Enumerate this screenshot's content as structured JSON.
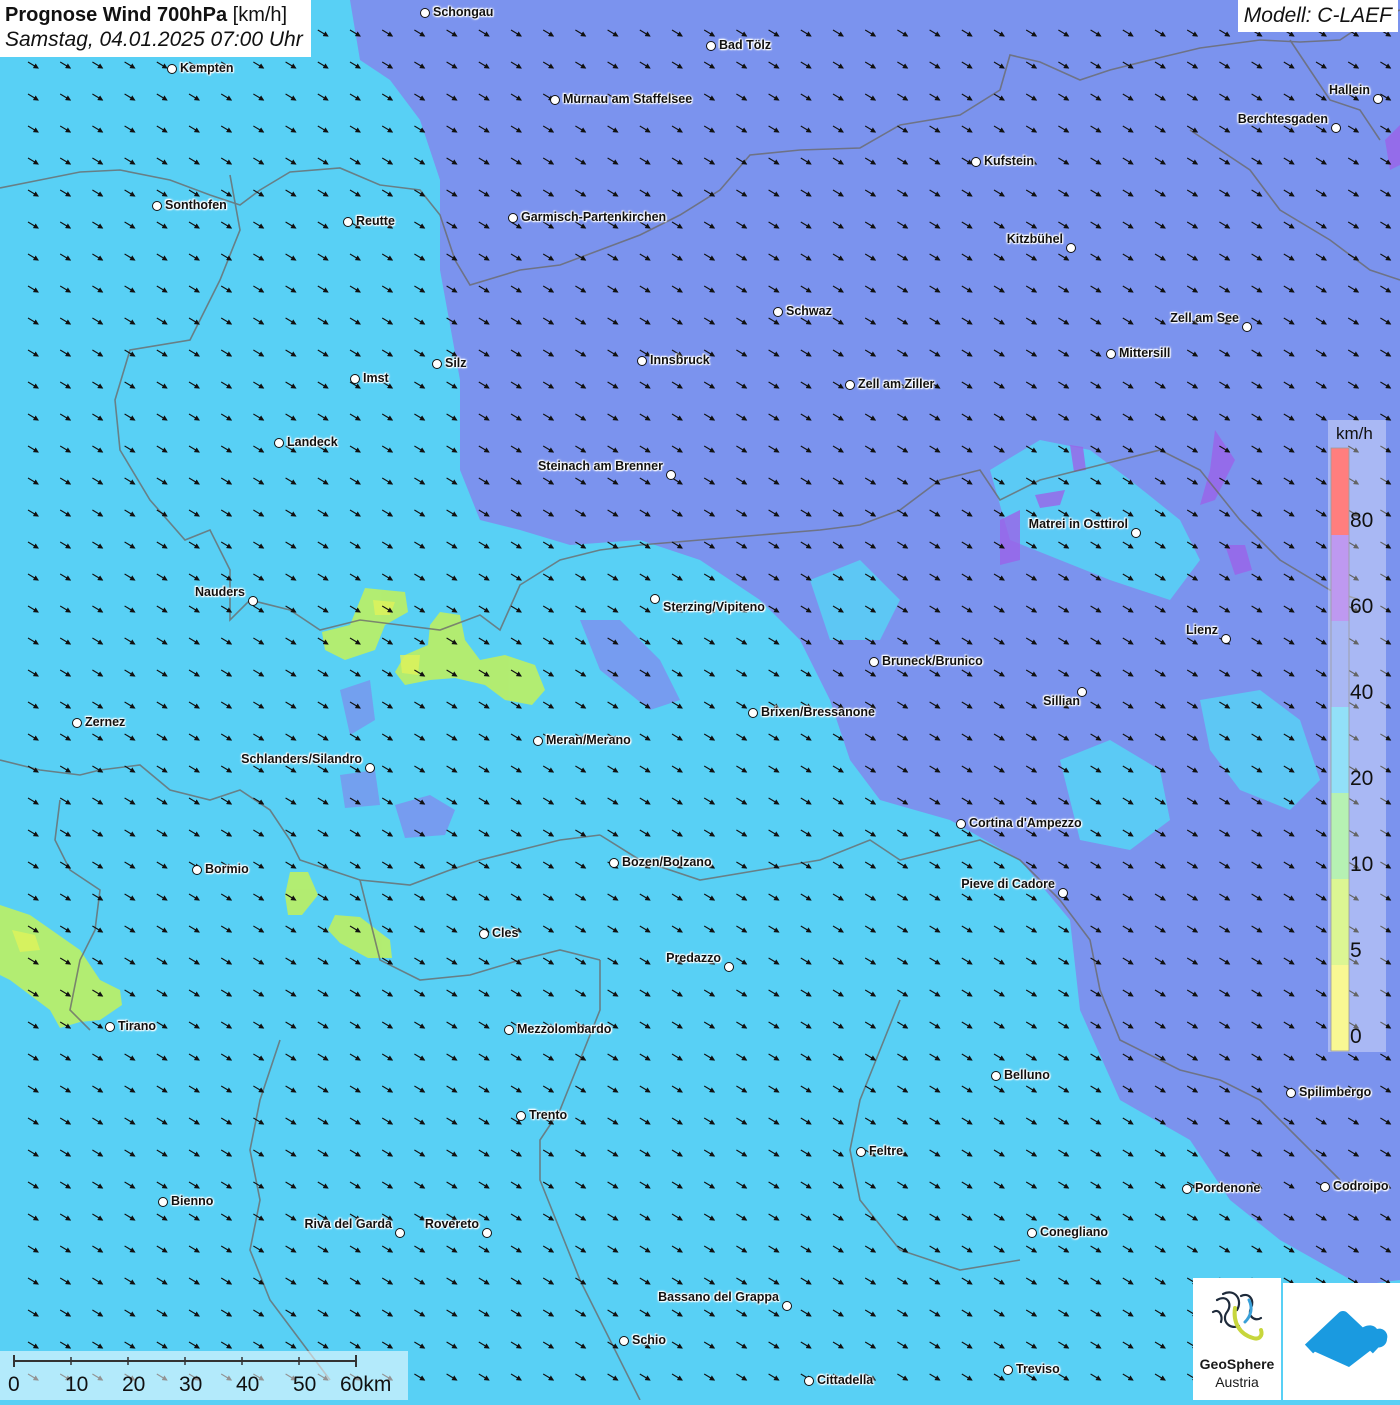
{
  "title": {
    "main": "Prognose Wind 700hPa",
    "unit": "[km/h]",
    "datetime": "Samstag, 04.01.2025 07:00 Uhr"
  },
  "model": "Modell: C-LAEF",
  "colors": {
    "wind_0_5": "#f6f55a",
    "wind_5_10": "#c9f15a",
    "wind_10_20": "#8fea8a",
    "wind_20_40": "#58d0f5",
    "wind_40_60": "#7b93ee",
    "wind_60_80": "#9b63e8",
    "wind_80_plus": "#ff3a3a",
    "border_lines": "#6b6b6b"
  },
  "legend": {
    "unit": "km/h",
    "ticks": [
      "0",
      "5",
      "10",
      "20",
      "40",
      "60",
      "80"
    ]
  },
  "scalebar": {
    "labels": [
      "0",
      "10",
      "20",
      "30",
      "40",
      "50",
      "60km"
    ]
  },
  "cities": [
    {
      "name": "Schongau"
    },
    {
      "name": "Bad Tölz"
    },
    {
      "name": "Kempten"
    },
    {
      "name": "Murnau am Staffelsee"
    },
    {
      "name": "Hallein"
    },
    {
      "name": "Berchtesgaden"
    },
    {
      "name": "Kufstein"
    },
    {
      "name": "Sonthofen"
    },
    {
      "name": "Reutte"
    },
    {
      "name": "Garmisch-Partenkirchen"
    },
    {
      "name": "Kitzbühel"
    },
    {
      "name": "Schwaz"
    },
    {
      "name": "Zell am See"
    },
    {
      "name": "Mittersill"
    },
    {
      "name": "Innsbruck"
    },
    {
      "name": "Silz"
    },
    {
      "name": "Imst"
    },
    {
      "name": "Zell am Ziller"
    },
    {
      "name": "Landeck"
    },
    {
      "name": "Steinach am Brenner"
    },
    {
      "name": "Matrei in Osttirol"
    },
    {
      "name": "Nauders"
    },
    {
      "name": "Sterzing/Vipiteno"
    },
    {
      "name": "Lienz"
    },
    {
      "name": "Bruneck/Brunico"
    },
    {
      "name": "Sillian"
    },
    {
      "name": "Brixen/Bressanone"
    },
    {
      "name": "Zernez"
    },
    {
      "name": "Meran/Merano"
    },
    {
      "name": "Schlanders/Silandro"
    },
    {
      "name": "Cortina d'Ampezzo"
    },
    {
      "name": "Bozen/Bolzano"
    },
    {
      "name": "Bormio"
    },
    {
      "name": "Pieve di Cadore"
    },
    {
      "name": "Cles"
    },
    {
      "name": "Predazzo"
    },
    {
      "name": "Tirano"
    },
    {
      "name": "Mezzolombardo"
    },
    {
      "name": "Belluno"
    },
    {
      "name": "Spilimbergo"
    },
    {
      "name": "Trento"
    },
    {
      "name": "Feltre"
    },
    {
      "name": "Pordenone"
    },
    {
      "name": "Codroipo"
    },
    {
      "name": "Bienno"
    },
    {
      "name": "Riva del Garda"
    },
    {
      "name": "Rovereto"
    },
    {
      "name": "Conegliano"
    },
    {
      "name": "Bassano del Grappa"
    },
    {
      "name": "Schio"
    },
    {
      "name": "Treviso"
    },
    {
      "name": "Cittadella"
    }
  ],
  "logos": {
    "geosphere_name": "GeoSphere",
    "geosphere_country": "Austria"
  },
  "icons": {
    "wind_arrow": "wind-arrow-icon",
    "geosphere_logo": "geosphere-logo-icon",
    "cloud_logo": "cloud-logo-icon"
  }
}
